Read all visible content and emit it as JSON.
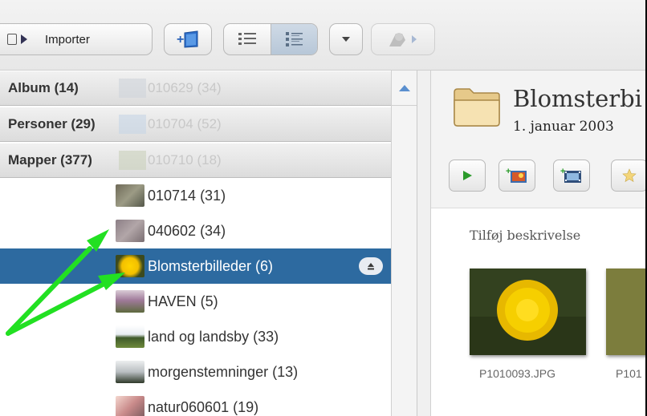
{
  "toolbar": {
    "import_label": "Importer"
  },
  "sidebar": {
    "headers": [
      {
        "label": "Album (14)",
        "ghost": "010629 (34)"
      },
      {
        "label": "Personer (29)",
        "ghost": "010704 (52)"
      },
      {
        "label": "Mapper (377)",
        "ghost": "010710 (18)"
      }
    ],
    "folders": [
      {
        "label": "010714 (31)"
      },
      {
        "label": "040602 (34)"
      },
      {
        "label": "Blomsterbilleder (6)",
        "selected": true
      },
      {
        "label": "HAVEN (5)"
      },
      {
        "label": "land og landsby (33)"
      },
      {
        "label": "morgenstemninger (13)"
      },
      {
        "label": "natur060601 (19)"
      }
    ]
  },
  "detail": {
    "title": "Blomsterbi",
    "date": "1. januar 2003",
    "description_placeholder": "Tilføj beskrivelse",
    "photos": [
      {
        "caption": "P1010093.JPG"
      },
      {
        "caption": "P101"
      }
    ]
  },
  "colors": {
    "selection": "#2d6aa0",
    "annotation_arrow": "#22e022"
  }
}
